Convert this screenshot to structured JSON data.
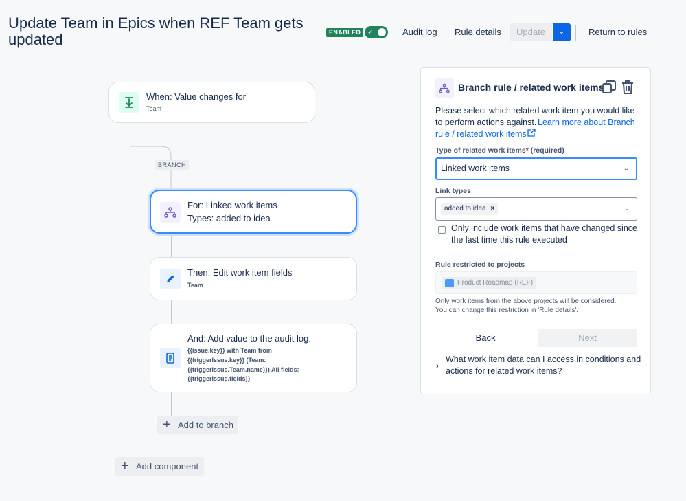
{
  "header": {
    "title": "Update Team in Epics when REF Team gets updated",
    "enabled_badge": "ENABLED",
    "audit_log": "Audit log",
    "rule_details": "Rule details",
    "update": "Update",
    "return_to_rules": "Return to rules"
  },
  "flow": {
    "trigger": {
      "title": "When: Value changes for",
      "subtitle": "Team"
    },
    "branch_label": "BRANCH",
    "branch_card": {
      "line1": "For: Linked work items",
      "line2": "Types: added to idea"
    },
    "edit_card": {
      "title": "Then: Edit work item fields",
      "subtitle": "Team"
    },
    "audit_card": {
      "title": "And: Add value to the audit log.",
      "line1": "{{issue.key}} with Team from",
      "line2": "{{triggerIssue.key}} (Team:",
      "line3": "{{triggerIssue.Team.name}}) All fields:",
      "line4": "{{triggerIssue.fields}}"
    },
    "add_to_branch": "Add to branch",
    "add_component": "Add component"
  },
  "panel": {
    "heading": "Branch rule / related work items",
    "intro_line1": "Please select which related work item you would like",
    "intro_line2": "to perform actions against.",
    "intro_link1": "Learn more about Branch",
    "intro_link2": "rule / related work items",
    "type_label": "Type of related work items",
    "required_star": "*",
    "required_text": "(required)",
    "type_value": "Linked work items",
    "link_types_label": "Link types",
    "link_type_chip": "added to idea",
    "checkbox_line1": "Only include work items that have changed since",
    "checkbox_line2": "the last time this rule executed",
    "restricted_label": "Rule restricted to projects",
    "project_chip": "Product Roadmap (REF)",
    "restrict_note1": "Only work items from the above projects will be considered.",
    "restrict_note2": "You can change this restriction in 'Rule details'.",
    "back": "Back",
    "next": "Next",
    "faq_line1": "What work item data can I access in conditions and",
    "faq_line2": "actions for related work items?"
  },
  "colors": {
    "primary": "#0c66e4",
    "enabled": "#1f845a",
    "selected_border": "#388bff"
  }
}
